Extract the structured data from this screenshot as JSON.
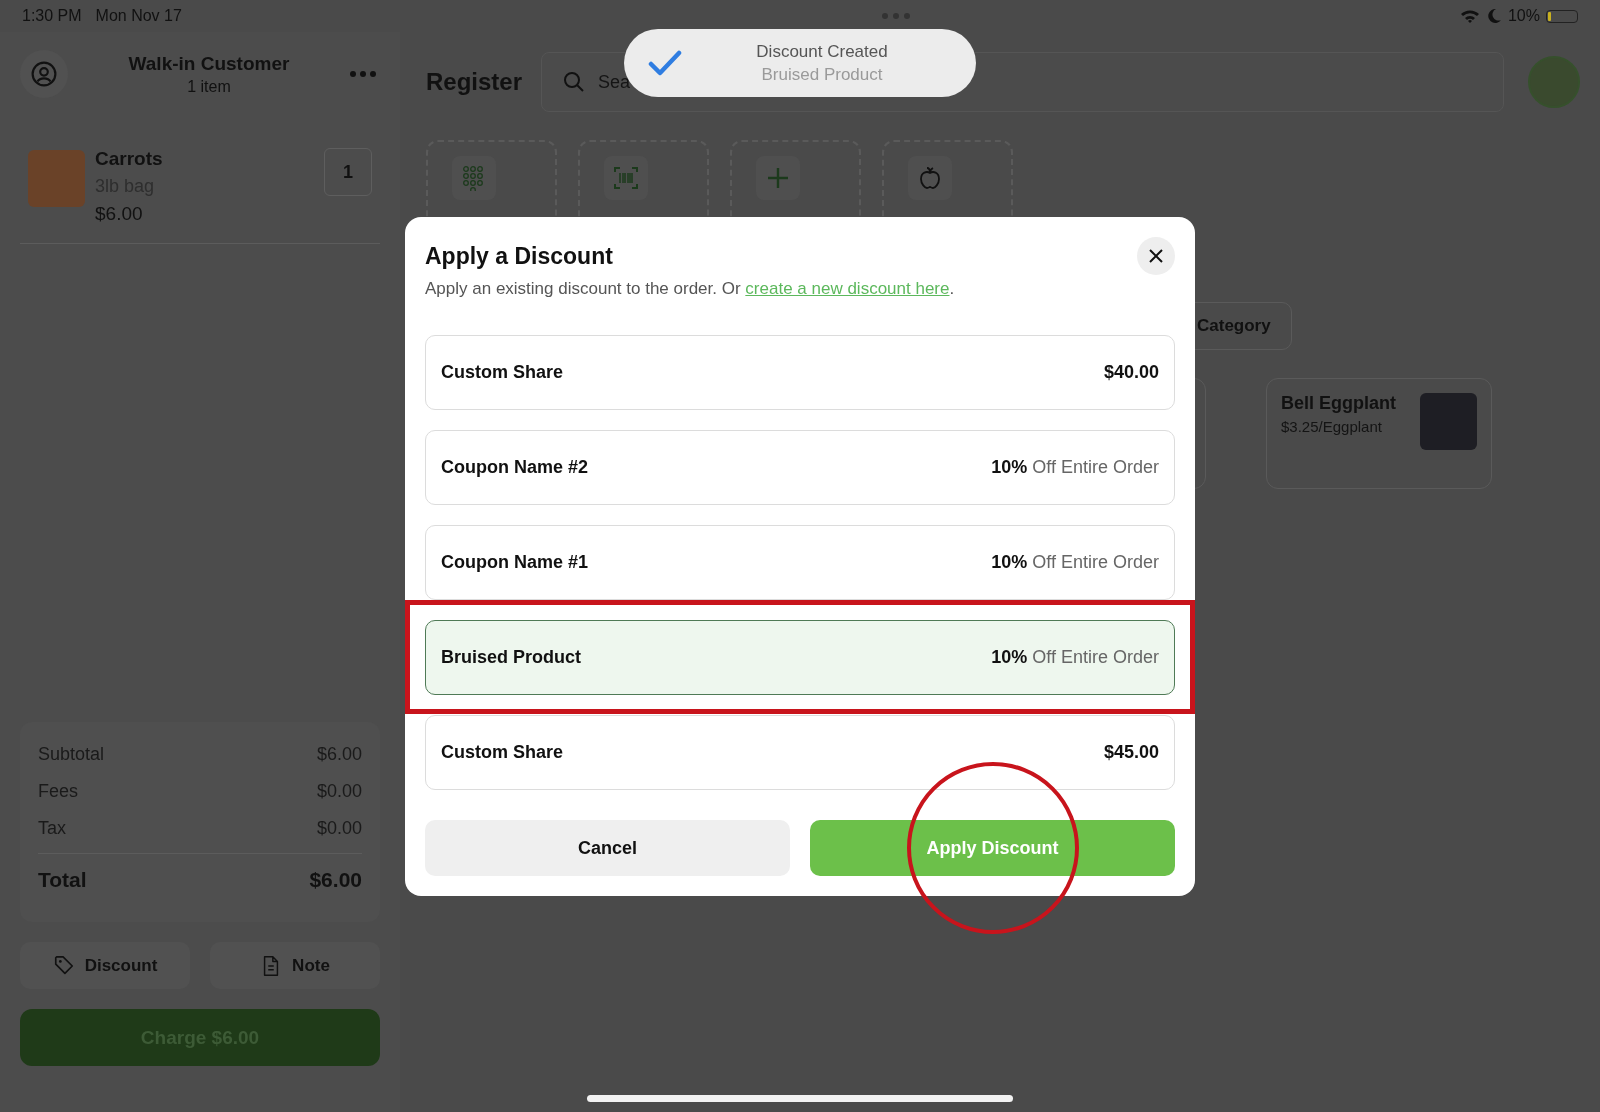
{
  "status_bar": {
    "time": "1:30 PM",
    "date": "Mon Nov 17",
    "battery": "10%"
  },
  "order": {
    "customer": "Walk-in Customer",
    "item_count": "1 item",
    "items": [
      {
        "name": "Carrots",
        "variant": "3lb bag",
        "price": "$6.00",
        "quantity": "1"
      }
    ],
    "summary": [
      {
        "label": "Subtotal",
        "value": "$6.00"
      },
      {
        "label": "Fees",
        "value": "$0.00"
      },
      {
        "label": "Tax",
        "value": "$0.00"
      }
    ],
    "total": {
      "label": "Total",
      "value": "$6.00"
    },
    "actions": [
      {
        "kind": "discount",
        "label": "Discount"
      },
      {
        "kind": "note",
        "label": "Note"
      }
    ],
    "charge_button": "Charge $6.00"
  },
  "register": {
    "title": "Register",
    "search": {
      "placeholder": "Sea"
    },
    "tiles": [
      {
        "kind": "keypad"
      },
      {
        "kind": "barcode"
      },
      {
        "kind": "add"
      },
      {
        "kind": "apple"
      }
    ],
    "filter_chip": "Category",
    "products": [
      {
        "name": "Bell Eggplant",
        "price": "$3.25/Eggplant"
      }
    ]
  },
  "toast": {
    "title": "Discount Created",
    "subtitle": "Bruised Product"
  },
  "dialog": {
    "title": "Apply a Discount",
    "subtitle": "Apply an existing discount to the order. Or ",
    "link": "create a new discount here",
    "subtitle_end": ".",
    "discounts": [
      {
        "name": "Custom Share",
        "kind": "amount",
        "value": "$40.00",
        "selected": false,
        "annotated": false
      },
      {
        "name": "Coupon Name #2",
        "kind": "percent",
        "value": "**10%** Off Entire Order",
        "selected": false,
        "annotated": false
      },
      {
        "name": "Coupon Name #1",
        "kind": "percent",
        "value": "**10%** Off Entire Order",
        "selected": false,
        "annotated": false
      },
      {
        "name": "Bruised Product",
        "kind": "percent",
        "value": "**10%** Off Entire Order",
        "selected": true,
        "annotated": true
      },
      {
        "name": "Custom Share",
        "kind": "amount",
        "value": "$45.00",
        "selected": false,
        "annotated": false
      }
    ],
    "actions": [
      {
        "kind": "secondary",
        "label": "Cancel",
        "annotated": false
      },
      {
        "kind": "primary",
        "label": "Apply Discount",
        "annotated": true
      }
    ]
  }
}
